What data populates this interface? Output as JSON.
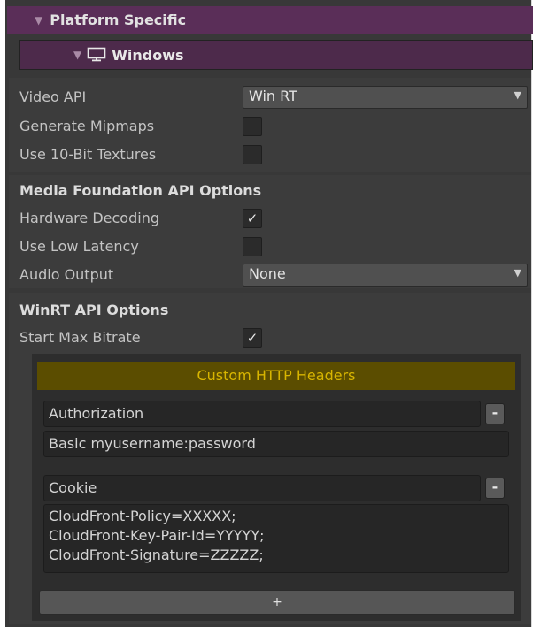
{
  "headers": {
    "platform_specific": "Platform Specific",
    "windows": "Windows"
  },
  "general": {
    "video_api_label": "Video API",
    "video_api_value": "Win RT",
    "generate_mipmaps_label": "Generate Mipmaps",
    "generate_mipmaps_checked": false,
    "use_10bit_label": "Use 10-Bit Textures",
    "use_10bit_checked": false
  },
  "media_foundation": {
    "title": "Media Foundation API Options",
    "hardware_decoding_label": "Hardware Decoding",
    "hardware_decoding_check": "✓",
    "low_latency_label": "Use Low Latency",
    "audio_output_label": "Audio Output",
    "audio_output_value": "None"
  },
  "winrt": {
    "title": "WinRT API Options",
    "start_max_bitrate_label": "Start Max Bitrate",
    "start_max_bitrate_check": "✓"
  },
  "http_headers": {
    "title": "Custom HTTP Headers",
    "entries": [
      {
        "name": "Authorization",
        "value": "Basic myusername:password",
        "remove_label": "-"
      },
      {
        "name": "Cookie",
        "value": "CloudFront-Policy=XXXXX;\nCloudFront-Key-Pair-Id=YYYYY;\nCloudFront-Signature=ZZZZZ;",
        "remove_label": "-"
      }
    ],
    "add_label": "+"
  },
  "colors": {
    "header_purple": "#5a2e58",
    "box_title_bg": "#5b4d00",
    "box_title_text": "#d8b500"
  },
  "icons": {
    "foldout": "triangle-down-icon",
    "windows": "monitor-icon"
  }
}
